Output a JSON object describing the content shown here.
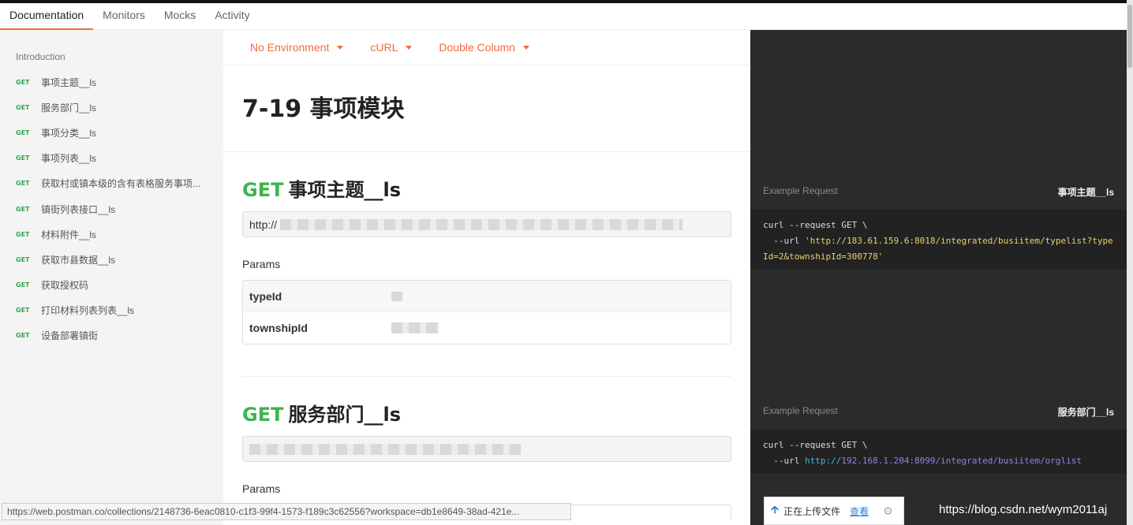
{
  "tabs": [
    "Documentation",
    "Monitors",
    "Mocks",
    "Activity"
  ],
  "sidebar": {
    "intro": "Introduction",
    "items": [
      {
        "method": "GET",
        "label": "事项主题__ls"
      },
      {
        "method": "GET",
        "label": "服务部门__ls"
      },
      {
        "method": "GET",
        "label": "事项分类__ls"
      },
      {
        "method": "GET",
        "label": "事项列表__ls"
      },
      {
        "method": "GET",
        "label": "获取村或镇本级的含有表格服务事项..."
      },
      {
        "method": "GET",
        "label": "镇街列表接口__ls"
      },
      {
        "method": "GET",
        "label": "材料附件__ls"
      },
      {
        "method": "GET",
        "label": "获取市县数据__ls"
      },
      {
        "method": "GET",
        "label": "获取授权码"
      },
      {
        "method": "GET",
        "label": "打印材料列表列表__ls"
      },
      {
        "method": "GET",
        "label": "设备部署镇街"
      }
    ]
  },
  "toolbar": {
    "environment": "No Environment",
    "language": "cURL",
    "layout": "Double Column"
  },
  "collection_title": "7-19 事项模块",
  "requests": [
    {
      "method": "GET",
      "name": "事项主题__ls",
      "url_prefix": "http://",
      "params_label": "Params",
      "params": [
        "typeId",
        "townshipId"
      ]
    },
    {
      "method": "GET",
      "name": "服务部门__ls",
      "params_label": "Params"
    }
  ],
  "examples": [
    {
      "label": "Example Request",
      "name": "事项主题__ls",
      "line1": "curl --request GET \\",
      "line2_prefix": "  --url ",
      "line2_url": "'http://183.61.159.6:8018/integrated/busiitem/typelist?type",
      "line3": "Id=2&townshipId=300778'"
    },
    {
      "label": "Example Request",
      "name": "服务部门__ls",
      "line1": "curl --request GET \\",
      "line2_prefix": "  --url ",
      "line2_scheme": "http://",
      "line2_url": "192.168.1.204:8099/integrated/busiitem/orglist"
    }
  ],
  "status_url": "https://web.postman.co/collections/2148736-6eac0810-c1f3-99f4-1573-f189c3c62556?workspace=db1e8649-38ad-421e...",
  "upload": {
    "text": "正在上传文件",
    "link": "查看"
  },
  "watermark": "https://blog.csdn.net/wym2011aj"
}
